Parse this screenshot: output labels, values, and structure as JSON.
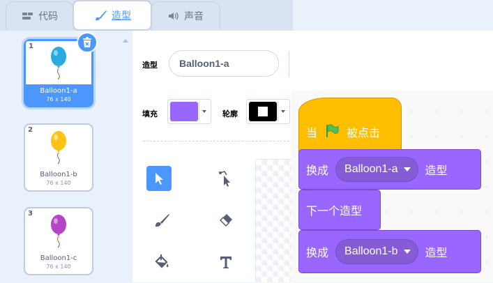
{
  "tabs": [
    {
      "label": "代码",
      "icon": "code-icon"
    },
    {
      "label": "造型",
      "icon": "brush-icon",
      "active": true
    },
    {
      "label": "声音",
      "icon": "speaker-icon"
    }
  ],
  "costumes": [
    {
      "number": "1",
      "name": "Balloon1-a",
      "size": "76 x 140",
      "color": "#29abe2",
      "selected": true
    },
    {
      "number": "2",
      "name": "Balloon1-b",
      "size": "76 x 140",
      "color": "#fbc314"
    },
    {
      "number": "3",
      "name": "Balloon1-c",
      "size": "76 x 140",
      "color": "#b545c6"
    }
  ],
  "editor": {
    "costume_label": "造型",
    "costume_name": "Balloon1-a",
    "fill_label": "填充",
    "fill_color": "#9966ff",
    "outline_label": "轮廓",
    "outline_color": "#000000"
  },
  "script": {
    "hat": {
      "prefix": "当",
      "suffix": "被点击",
      "icon": "green-flag-icon"
    },
    "switch1": {
      "prefix": "换成",
      "value": "Balloon1-a",
      "suffix": "造型"
    },
    "next": {
      "label": "下一个造型"
    },
    "switch2": {
      "prefix": "换成",
      "value": "Balloon1-b",
      "suffix": "造型"
    }
  },
  "colors": {
    "accent": "#4c97ff",
    "events": "#ffbf00",
    "looks": "#9966ff"
  }
}
